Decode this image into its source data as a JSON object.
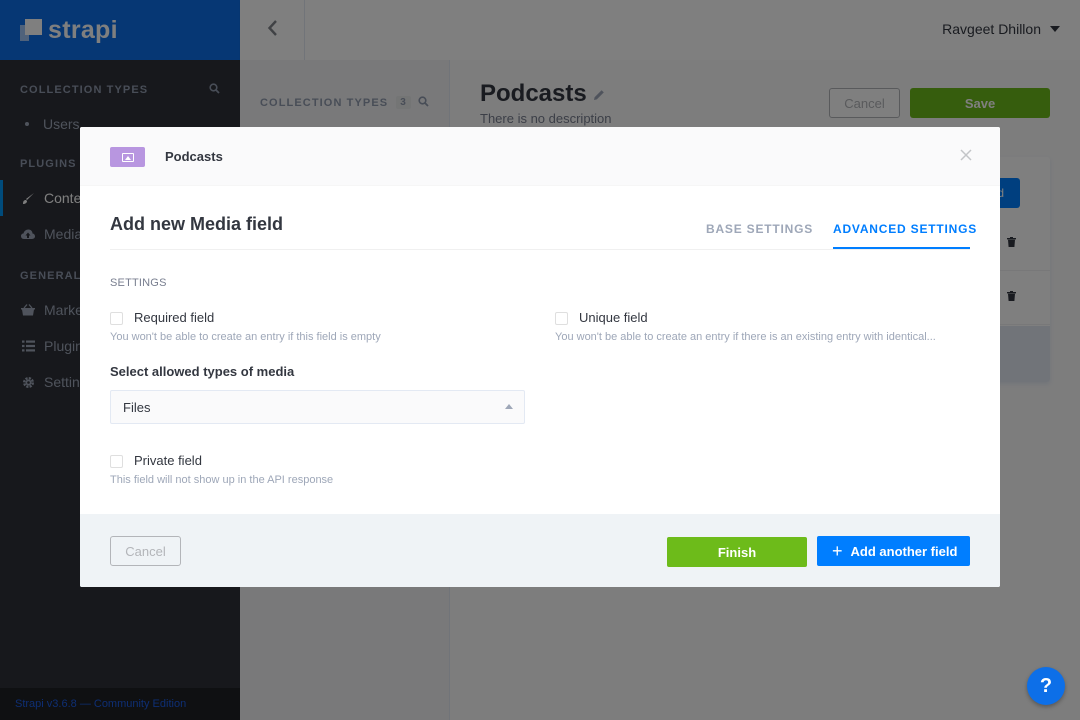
{
  "brand": {
    "name": "strapi",
    "color": "#0d6fe8"
  },
  "leftnav": {
    "collection_types_label": "COLLECTION TYPES",
    "collection_items": [
      {
        "label": "Users"
      }
    ],
    "plugins_label": "PLUGINS",
    "plugin_items": [
      {
        "label": "Content-Types Builder",
        "icon": "paintbrush-icon",
        "active": true
      },
      {
        "label": "Media Library",
        "icon": "cloud-upload-icon"
      }
    ],
    "general_label": "GENERAL",
    "general_items": [
      {
        "label": "Marketplace",
        "icon": "basket-icon"
      },
      {
        "label": "Plugins",
        "icon": "list-icon"
      },
      {
        "label": "Settings",
        "icon": "gear-icon"
      }
    ],
    "version": "Strapi v3.6.8 — Community Edition"
  },
  "header": {
    "user": "Ravgeet Dhillon"
  },
  "builder_sidebar": {
    "title": "COLLECTION TYPES",
    "count": "3"
  },
  "content": {
    "title": "Podcasts",
    "description": "There is no description",
    "cancel_label": "Cancel",
    "save_label": "Save",
    "add_field_label": "d"
  },
  "modal": {
    "content_type_name": "Podcasts",
    "title": "Add new Media field",
    "tabs": [
      {
        "label": "BASE SETTINGS",
        "active": false
      },
      {
        "label": "ADVANCED SETTINGS",
        "active": true
      }
    ],
    "settings_label": "SETTINGS",
    "required_field": {
      "label": "Required field",
      "description": "You won't be able to create an entry if this field is empty",
      "checked": false
    },
    "unique_field": {
      "label": "Unique field",
      "description": "You won't be able to create an entry if there is an existing entry with identical...",
      "checked": false
    },
    "media_types": {
      "label": "Select allowed types of media",
      "value": "Files"
    },
    "private_field": {
      "label": "Private field",
      "description": "This field will not show up in the API response",
      "checked": false
    },
    "footer": {
      "cancel_label": "Cancel",
      "finish_label": "Finish",
      "add_another_label": "Add another field"
    }
  },
  "help": {
    "label": "?"
  },
  "colors": {
    "primary": "#007eff",
    "success": "#6dbb1a",
    "media_type": "#b896e0"
  }
}
